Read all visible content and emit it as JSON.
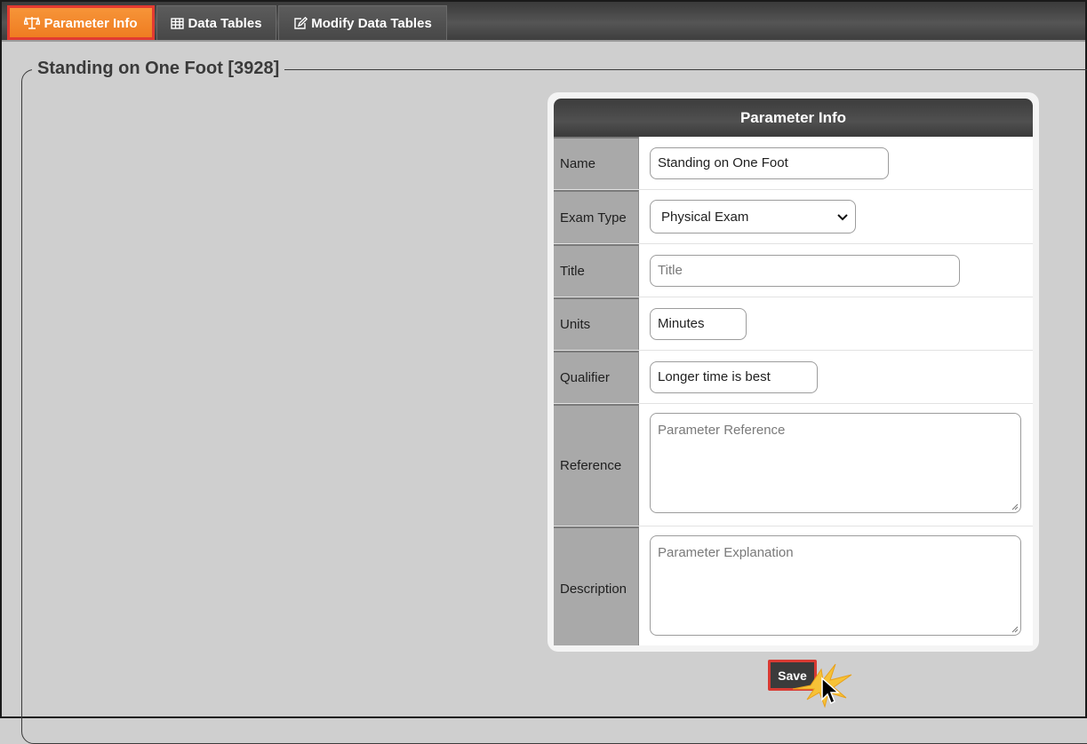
{
  "tabs": [
    {
      "label": "Parameter Info",
      "icon": "balance-scale-icon",
      "active": true
    },
    {
      "label": "Data Tables",
      "icon": "table-icon",
      "active": false
    },
    {
      "label": "Modify Data Tables",
      "icon": "edit-icon",
      "active": false
    }
  ],
  "page": {
    "legend": "Standing on One Foot [3928]"
  },
  "panel": {
    "title": "Parameter Info",
    "fields": {
      "name": {
        "label": "Name",
        "value": "Standing on One Foot"
      },
      "exam_type": {
        "label": "Exam Type",
        "value": "Physical Exam"
      },
      "title": {
        "label": "Title",
        "placeholder": "Title"
      },
      "units": {
        "label": "Units",
        "value": "Minutes"
      },
      "qualifier": {
        "label": "Qualifier",
        "value": "Longer time is best"
      },
      "reference": {
        "label": "Reference",
        "placeholder": "Parameter Reference"
      },
      "description": {
        "label": "Description",
        "placeholder": "Parameter Explanation"
      }
    }
  },
  "actions": {
    "save_label": "Save"
  },
  "colors": {
    "accent": "#f08428",
    "highlight": "#e23a31",
    "header": "#444444"
  }
}
